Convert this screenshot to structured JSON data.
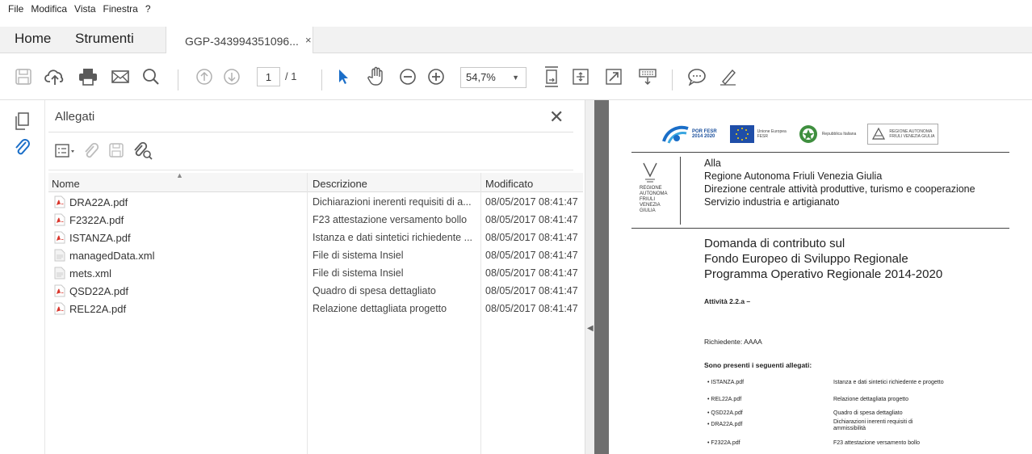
{
  "menu": [
    "File",
    "Modifica",
    "Vista",
    "Finestra",
    "?"
  ],
  "tabs": {
    "home": "Home",
    "tools": "Strumenti",
    "document": "GGP-343994351096...",
    "document_close": "×"
  },
  "toolbar": {
    "page_current": "1",
    "page_total": "/ 1",
    "zoom": "54,7%"
  },
  "attachments": {
    "title": "Allegati",
    "columns": {
      "name": "Nome",
      "description": "Descrizione",
      "modified": "Modificato"
    },
    "rows": [
      {
        "name": "DRA22A.pdf",
        "type": "pdf",
        "description": "Dichiarazioni inerenti requisiti di a...",
        "modified": "08/05/2017 08:41:47"
      },
      {
        "name": "F2322A.pdf",
        "type": "pdf",
        "description": "F23 attestazione versamento bollo",
        "modified": "08/05/2017 08:41:47"
      },
      {
        "name": "ISTANZA.pdf",
        "type": "pdf",
        "description": "Istanza e dati sintetici richiedente ...",
        "modified": "08/05/2017 08:41:47"
      },
      {
        "name": "managedData.xml",
        "type": "xml",
        "description": "File di sistema Insiel",
        "modified": "08/05/2017 08:41:47"
      },
      {
        "name": "mets.xml",
        "type": "xml",
        "description": "File di sistema Insiel",
        "modified": "08/05/2017 08:41:47"
      },
      {
        "name": "QSD22A.pdf",
        "type": "pdf",
        "description": "Quadro di spesa dettagliato",
        "modified": "08/05/2017 08:41:47"
      },
      {
        "name": "REL22A.pdf",
        "type": "pdf",
        "description": "Relazione dettagliata progetto",
        "modified": "08/05/2017 08:41:47"
      }
    ]
  },
  "document": {
    "logos": {
      "por_fesr": "POR FESR",
      "por_years": "2014 2020",
      "eu_line1": "Unione Europea",
      "eu_line2": "FESR",
      "repubblica": "Repubblica Italiana",
      "regione_line1": "REGIONE AUTONOMA",
      "regione_line2": "FRIULI VENEZIA GIULIA"
    },
    "crest_text": "REGIONE AUTONOMA FRIULI VENEZIA GIULIA",
    "address": [
      "Alla",
      "Regione Autonoma Friuli Venezia Giulia",
      "Direzione centrale attività produttive, turismo e cooperazione",
      "Servizio industria e artigianato"
    ],
    "title_lines": [
      "Domanda di contributo sul",
      "Fondo Europeo di Sviluppo Regionale",
      "Programma Operativo Regionale 2014-2020"
    ],
    "activity": "Attività 2.2.a –",
    "applicant": "Richiedente: AAAA",
    "attachments_heading": "Sono presenti i seguenti allegati:",
    "attachment_list": [
      {
        "file": "ISTANZA.pdf",
        "desc": "Istanza e dati sintetici richiedente e progetto"
      },
      {
        "file": "REL22A.pdf",
        "desc": "Relazione dettagliata progetto"
      },
      {
        "file": "QSD22A.pdf",
        "desc": "Quadro di spesa dettagliato"
      },
      {
        "file": "DRA22A.pdf",
        "desc": "Dichiarazioni inerenti requisiti di ammissibilità"
      },
      {
        "file": "F2322A.pdf",
        "desc": "F23 attestazione versamento bollo"
      }
    ]
  },
  "colors": {
    "accent_blue": "#1a6ec8",
    "pdf_red": "#d9352b",
    "icon_gray": "#6b6b6b",
    "doc_gray_bar": "#6f6f6f"
  }
}
